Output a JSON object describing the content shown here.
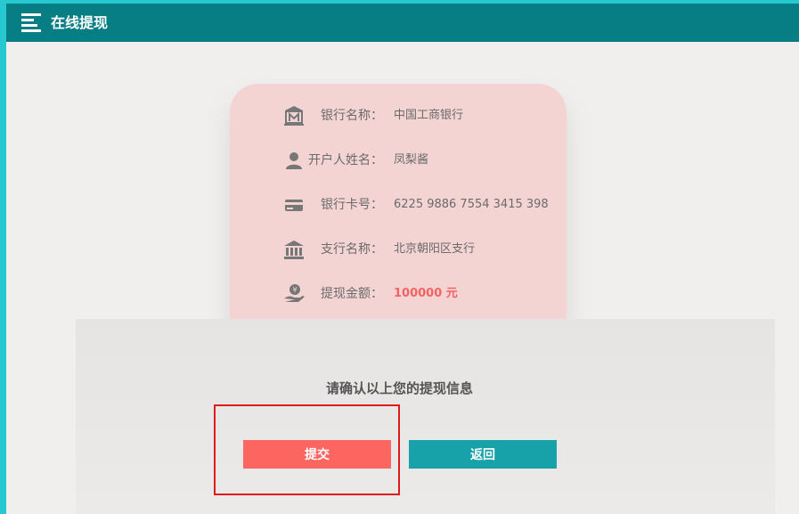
{
  "header": {
    "title": "在线提现"
  },
  "card": {
    "rows": [
      {
        "icon": "bank-logo-icon",
        "label": "银行名称：",
        "value": "中国工商银行"
      },
      {
        "icon": "user-icon",
        "label": "开户人姓名：",
        "value": "凤梨酱"
      },
      {
        "icon": "credit-card-icon",
        "label": "银行卡号：",
        "value": "6225 9886 7554 3415 398"
      },
      {
        "icon": "bank-building-icon",
        "label": "支行名称：",
        "value": "北京朝阳区支行"
      },
      {
        "icon": "money-hand-icon",
        "label": "提现金额：",
        "value": "100000 元"
      }
    ]
  },
  "confirm_text": "请确认以上您的提现信息",
  "buttons": {
    "submit": "提交",
    "back": "返回"
  },
  "colors": {
    "header": "#077d84",
    "accent_border": "#27c8cf",
    "card": "#f3d4d3",
    "submit": "#fd6660",
    "back": "#17a1a8",
    "amount": "#f56262",
    "highlight": "#e11b1b"
  }
}
